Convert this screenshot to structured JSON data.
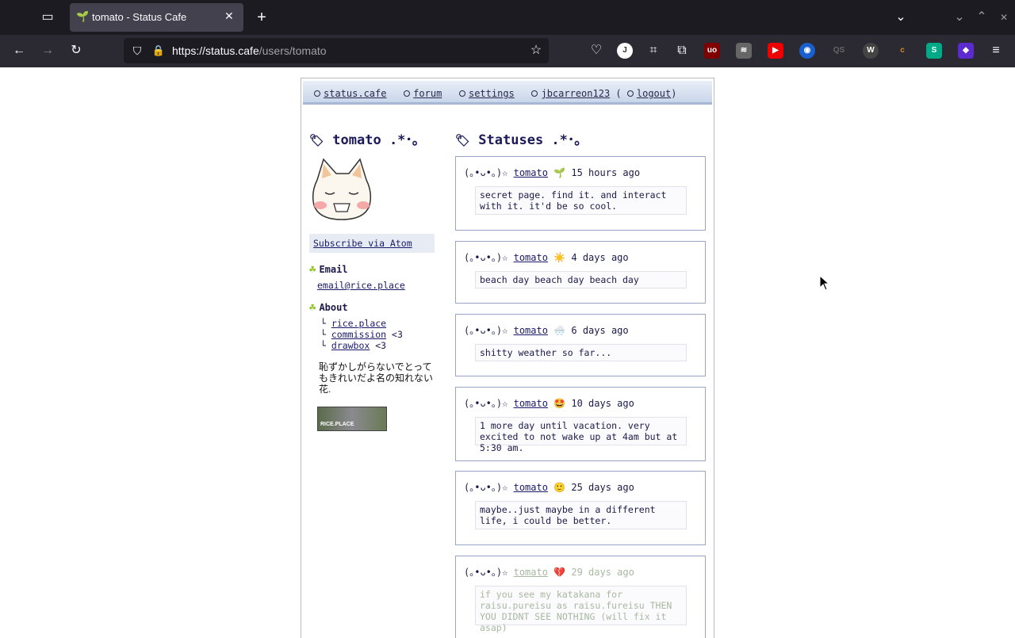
{
  "browser": {
    "tab_title": "tomato - Status Cafe",
    "url_host": "https://status.cafe",
    "url_path": "/users/tomato",
    "extensions": [
      {
        "name": "pocket",
        "color": "#2b2a33"
      },
      {
        "name": "j",
        "color": "#2b2a33",
        "badge": ""
      },
      {
        "name": "ublock",
        "color": "#800000"
      },
      {
        "name": "youtube",
        "color": "#e00"
      },
      {
        "name": "blue-circle",
        "color": "#1a5fd0"
      },
      {
        "name": "wiki",
        "color": "#2b2a33"
      },
      {
        "name": "stylus",
        "color": "#0a8",
        "badge": "1"
      },
      {
        "name": "shield",
        "color": "#5b2bd0",
        "badge": "3"
      }
    ]
  },
  "nav": {
    "site": "status.cafe",
    "forum": "forum",
    "settings": "settings",
    "user": "jbcarreon123",
    "logout": "logout",
    "open_paren": "(",
    "close_paren": ")"
  },
  "profile": {
    "title": "tomato .*･｡",
    "subscribe": "Subscribe via Atom",
    "email_heading": "Email",
    "email": "email@rice.place",
    "about_heading": "About",
    "links": [
      {
        "text": "rice.place",
        "suffix": ""
      },
      {
        "text": "commission",
        "suffix": " <3"
      },
      {
        "text": "drawbox",
        "suffix": " <3"
      }
    ],
    "bio": "恥ずかしがらないでとってもきれいだよ名の知れない花.",
    "banner_text": "RICE.PLACE"
  },
  "statuses": {
    "title": "Statuses .*･｡",
    "kaomoji": "(｡•ᴗ•｡)☆",
    "items": [
      {
        "user": "tomato",
        "emoji": "🌱",
        "time": "15 hours ago",
        "text": "secret page. find it. and interact with it. it'd be so cool."
      },
      {
        "user": "tomato",
        "emoji": "☀️",
        "time": "4 days ago",
        "text": "beach day beach day beach day"
      },
      {
        "user": "tomato",
        "emoji": "🌨️",
        "time": "6 days ago",
        "text": "shitty weather so far..."
      },
      {
        "user": "tomato",
        "emoji": "🤩",
        "time": "10 days ago",
        "text": "1 more day until vacation. very excited to not wake up at 4am but at 5:30 am."
      },
      {
        "user": "tomato",
        "emoji": "🙂",
        "time": "25 days ago",
        "text": "maybe..just maybe in a different life, i could be better."
      },
      {
        "user": "tomato",
        "emoji": "💔",
        "time": "29 days ago",
        "text": "if you see my katakana for raisu.pureisu as raisu.fureisu THEN YOU DIDNT SEE NOTHING (will fix it asap)"
      }
    ]
  }
}
